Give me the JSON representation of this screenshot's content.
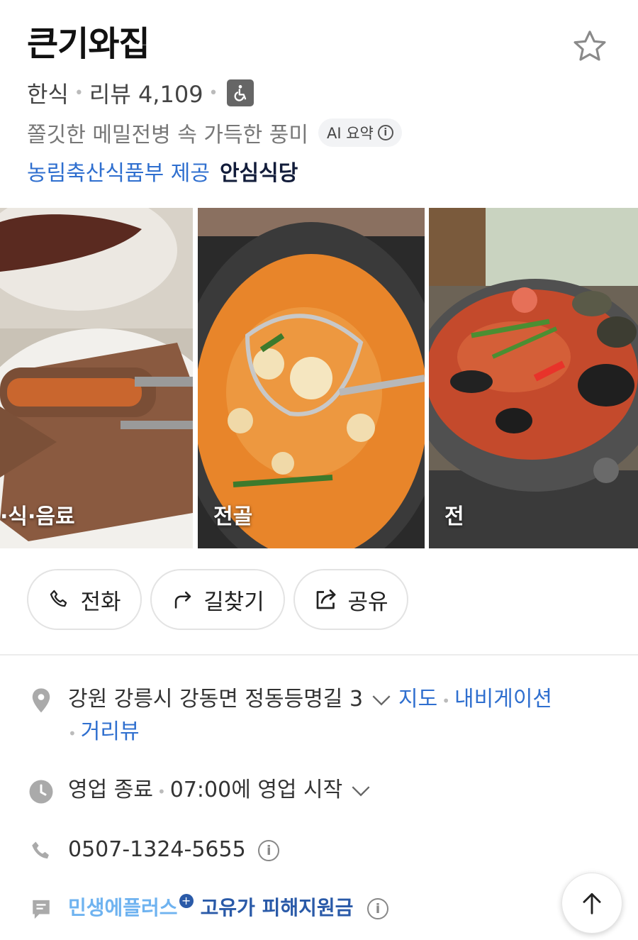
{
  "place": {
    "name": "큰기와집",
    "category": "한식",
    "review_label": "리뷰",
    "review_count": "4,109",
    "accessibility_icon": "wheelchair-icon",
    "description": "쫄깃한 메밀전병 속 가득한 풍미",
    "ai_label": "AI 요약",
    "cert_source": "농림축산식품부 제공",
    "cert_name": "안심식당"
  },
  "photos": [
    {
      "label": "·식·음료"
    },
    {
      "label": "전골"
    },
    {
      "label": "전"
    }
  ],
  "actions": {
    "call": "전화",
    "directions": "길찾기",
    "share": "공유"
  },
  "details": {
    "address": "강원 강릉시 강동면 정동등명길 3",
    "map_link": "지도",
    "navi_link": "내비게이션",
    "street_link": "거리뷰",
    "status": "영업 종료",
    "hours": "07:00에 영업 시작",
    "phone": "0507-1324-5655",
    "promo_a": "민생에플러스",
    "promo_plus": "+",
    "promo_b": "고유가 피해지원금"
  },
  "colors": {
    "link": "#2f6fcf",
    "promo_light": "#6fb3f0",
    "promo_dark": "#2a5aa8"
  }
}
